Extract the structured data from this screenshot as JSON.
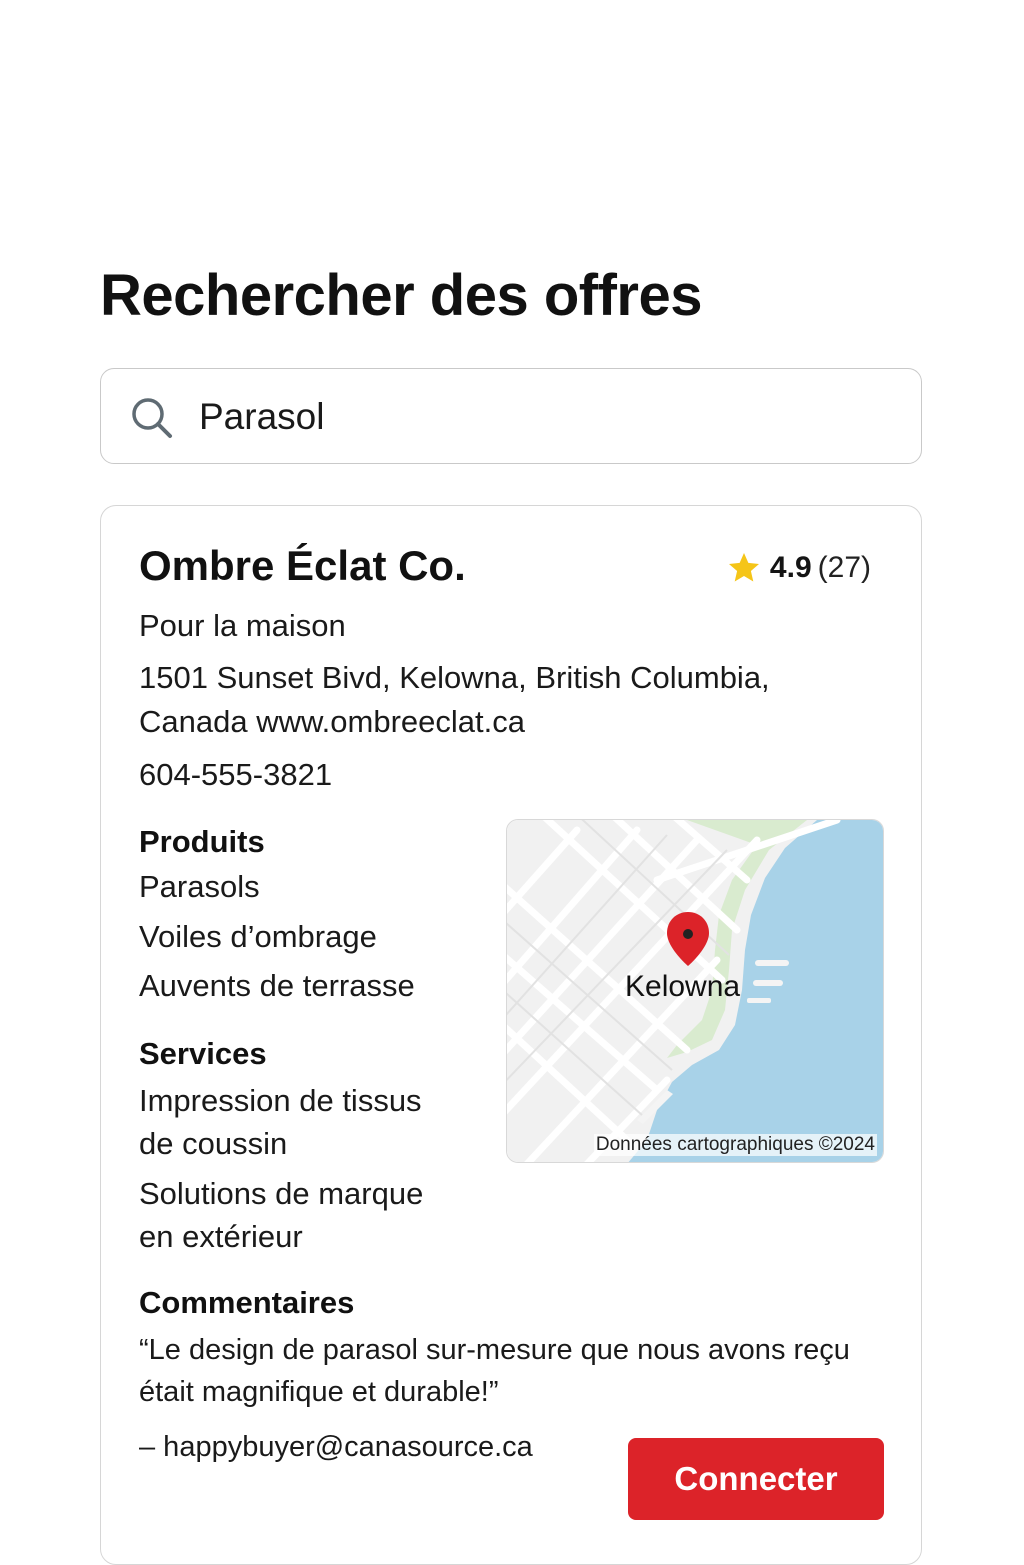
{
  "page": {
    "title": "Rechercher des offres"
  },
  "search": {
    "value": "Parasol",
    "icon": "search-icon"
  },
  "listing": {
    "name": "Ombre Éclat Co.",
    "rating": {
      "value": "4.9",
      "count": "(27)",
      "icon": "star-icon",
      "star_color": "#f5c518"
    },
    "category": "Pour la maison",
    "address_line1": "1501 Sunset Bivd, Kelowna, British Columbia,",
    "address_line2": "Canada  www.ombreeclat.ca",
    "phone": "604-555-3821",
    "products": {
      "heading": "Produits",
      "items": [
        "Parasols",
        "Voiles d’ombrage",
        "Auvents de terrasse"
      ]
    },
    "services": {
      "heading": "Services",
      "items": [
        [
          "Impression de tissus",
          "de coussin"
        ],
        [
          "Solutions de marque",
          "en extérieur"
        ]
      ]
    },
    "map": {
      "city_label": "Kelowna",
      "credit": "Données cartographiques ©2024",
      "pin_color": "#dc2329",
      "water_color": "#a8d2e8"
    },
    "reviews": {
      "heading": "Commentaires",
      "quote": "“Le design de parasol sur-mesure que nous avons reçu était magnifique et durable!”",
      "author": "– happybuyer@canasource.ca"
    },
    "connect_label": "Connecter",
    "accent_color": "#dc2329"
  }
}
